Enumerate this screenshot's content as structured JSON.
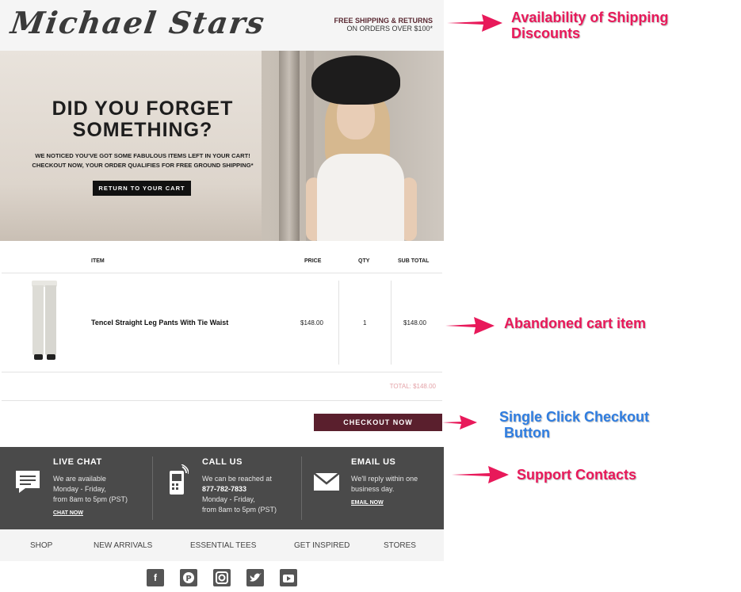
{
  "header": {
    "logo_text": "Michael Stars",
    "shipping_line1": "FREE SHIPPING & RETURNS",
    "shipping_line2": "ON ORDERS OVER $100*"
  },
  "hero": {
    "title_line1": "DID YOU FORGET",
    "title_line2": "SOMETHING?",
    "body_line1": "WE NOTICED YOU'VE GOT SOME FABULOUS ITEMS LEFT IN YOUR CART!",
    "body_line2": "CHECKOUT NOW, YOUR ORDER QUALIFIES FOR FREE GROUND SHIPPING*",
    "button_label": "RETURN TO YOUR CART"
  },
  "cart": {
    "headers": {
      "item": "ITEM",
      "price": "PRICE",
      "qty": "QTY",
      "subtotal": "SUB TOTAL"
    },
    "items": [
      {
        "name": "Tencel Straight Leg Pants With Tie Waist",
        "price": "$148.00",
        "qty": "1",
        "subtotal": "$148.00"
      }
    ],
    "total_label": "TOTAL: $148.00",
    "checkout_label": "CHECKOUT NOW"
  },
  "support": {
    "live_chat": {
      "title": "LIVE CHAT",
      "line1": "We are available",
      "line2": "Monday - Friday,",
      "line3": "from 8am to 5pm (PST)",
      "link": "CHAT NOW"
    },
    "call_us": {
      "title": "CALL US",
      "line1": "We can be reached at",
      "phone": "877-782-7833",
      "line3": "Monday - Friday,",
      "line4": "from 8am to 5pm (PST)"
    },
    "email_us": {
      "title": "EMAIL US",
      "line1": "We'll reply within one",
      "line2": "business day.",
      "link": "EMAIL NOW"
    }
  },
  "nav": {
    "items": [
      "SHOP",
      "NEW ARRIVALS",
      "ESSENTIAL TEES",
      "GET INSPIRED",
      "STORES"
    ]
  },
  "social": {
    "icons": [
      "facebook-icon",
      "pinterest-icon",
      "instagram-icon",
      "twitter-icon",
      "youtube-icon"
    ]
  },
  "annotations": {
    "shipping_line1": "Availability of Shipping",
    "shipping_line2": "Discounts",
    "cart_item": "Abandoned cart item",
    "checkout_line1": "Single Click Checkout",
    "checkout_line2": "Button",
    "support": "Support Contacts",
    "color_pink": "#e8195a",
    "color_blue": "#2f7de0"
  }
}
